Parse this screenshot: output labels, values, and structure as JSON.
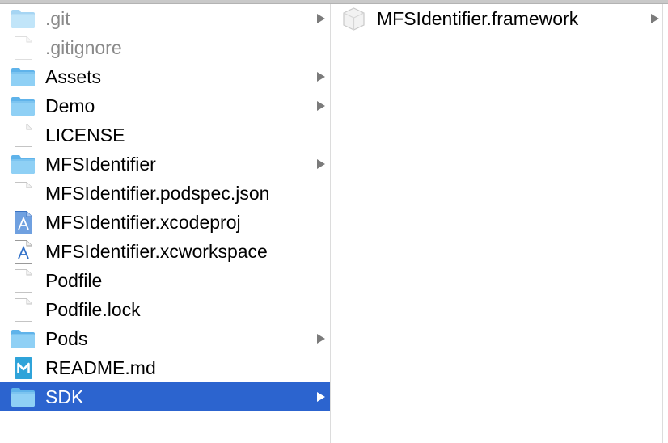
{
  "colors": {
    "folder": "#75c4f0",
    "selection": "#2c64cf",
    "arrow": "#7b7b7b"
  },
  "column1": {
    "items": [
      {
        "name": ".git",
        "icon": "folder-icon",
        "type": "folder",
        "hidden": true,
        "has_children": true
      },
      {
        "name": ".gitignore",
        "icon": "file-icon",
        "type": "file",
        "hidden": true,
        "has_children": false
      },
      {
        "name": "Assets",
        "icon": "folder-icon",
        "type": "folder",
        "has_children": true
      },
      {
        "name": "Demo",
        "icon": "folder-icon",
        "type": "folder",
        "has_children": true
      },
      {
        "name": "LICENSE",
        "icon": "file-icon",
        "type": "file",
        "has_children": false
      },
      {
        "name": "MFSIdentifier",
        "icon": "folder-icon",
        "type": "folder",
        "has_children": true
      },
      {
        "name": "MFSIdentifier.podspec.json",
        "icon": "file-icon",
        "type": "file",
        "has_children": false
      },
      {
        "name": "MFSIdentifier.xcodeproj",
        "icon": "xcodeproj-icon",
        "type": "xcodeproj",
        "has_children": false
      },
      {
        "name": "MFSIdentifier.xcworkspace",
        "icon": "xcworkspace-icon",
        "type": "xcworkspace",
        "has_children": false
      },
      {
        "name": "Podfile",
        "icon": "file-icon",
        "type": "file",
        "has_children": false
      },
      {
        "name": "Podfile.lock",
        "icon": "file-icon",
        "type": "file",
        "has_children": false
      },
      {
        "name": "Pods",
        "icon": "folder-icon",
        "type": "folder",
        "has_children": true
      },
      {
        "name": "README.md",
        "icon": "markdown-icon",
        "type": "markdown",
        "has_children": false
      },
      {
        "name": "SDK",
        "icon": "folder-icon",
        "type": "folder",
        "selected": true,
        "has_children": true
      }
    ]
  },
  "column2": {
    "items": [
      {
        "name": "MFSIdentifier.framework",
        "icon": "framework-icon",
        "type": "framework",
        "has_children": true
      }
    ]
  }
}
